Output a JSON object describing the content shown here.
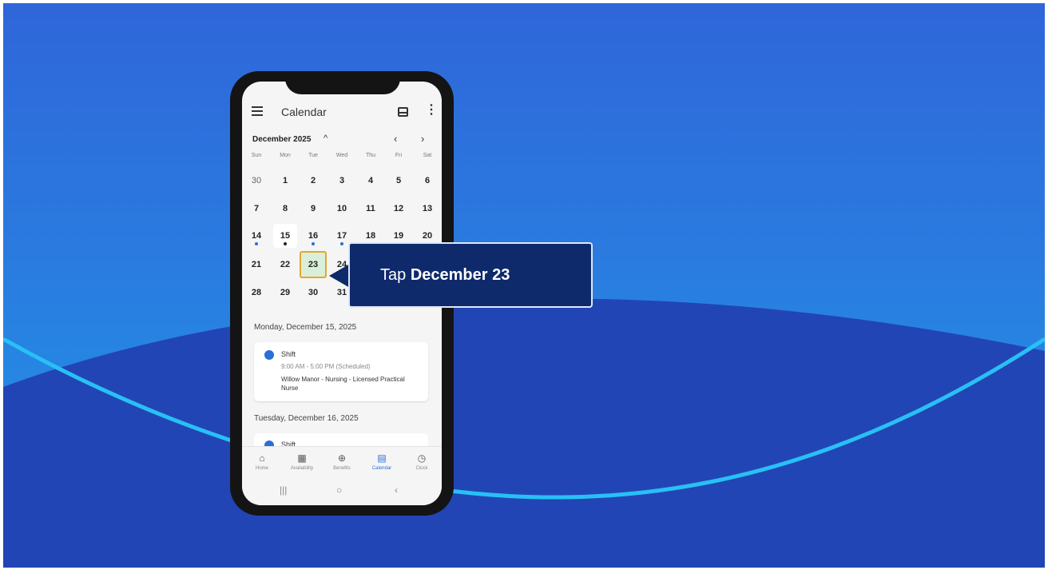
{
  "app": {
    "title": "Calendar"
  },
  "calendar": {
    "month_label": "December 2025",
    "weekdays": [
      "Sun",
      "Mon",
      "Tue",
      "Wed",
      "Thu",
      "Fri",
      "Sat"
    ],
    "weeks": [
      [
        "30",
        "1",
        "2",
        "3",
        "4",
        "5",
        "6"
      ],
      [
        "7",
        "8",
        "9",
        "10",
        "11",
        "12",
        "13"
      ],
      [
        "14",
        "15",
        "16",
        "17",
        "18",
        "19",
        "20"
      ],
      [
        "21",
        "22",
        "23",
        "24",
        "",
        "",
        ""
      ],
      [
        "28",
        "29",
        "30",
        "31",
        "",
        "",
        ""
      ]
    ],
    "highlighted_day": "23",
    "today_day": "15"
  },
  "schedule": [
    {
      "date_label": "Monday, December 15, 2025",
      "title": "Shift",
      "time": "9:00 AM - 5:00 PM (Scheduled)",
      "desc": "Willow Manor - Nursing - Licensed Practical Nurse"
    },
    {
      "date_label": "Tuesday, December 16, 2025",
      "title": "Shift"
    }
  ],
  "bottom_nav": {
    "home": "Home",
    "availability": "Availability",
    "benefits": "Benefits",
    "calendar": "Calendar",
    "clock": "Clock"
  },
  "callout": {
    "prefix": "Tap",
    "emphasis": "December 23"
  },
  "colors": {
    "accent": "#2a6fd6",
    "callout_bg": "#0f2a6b",
    "highlight_border": "#e3a82a"
  }
}
